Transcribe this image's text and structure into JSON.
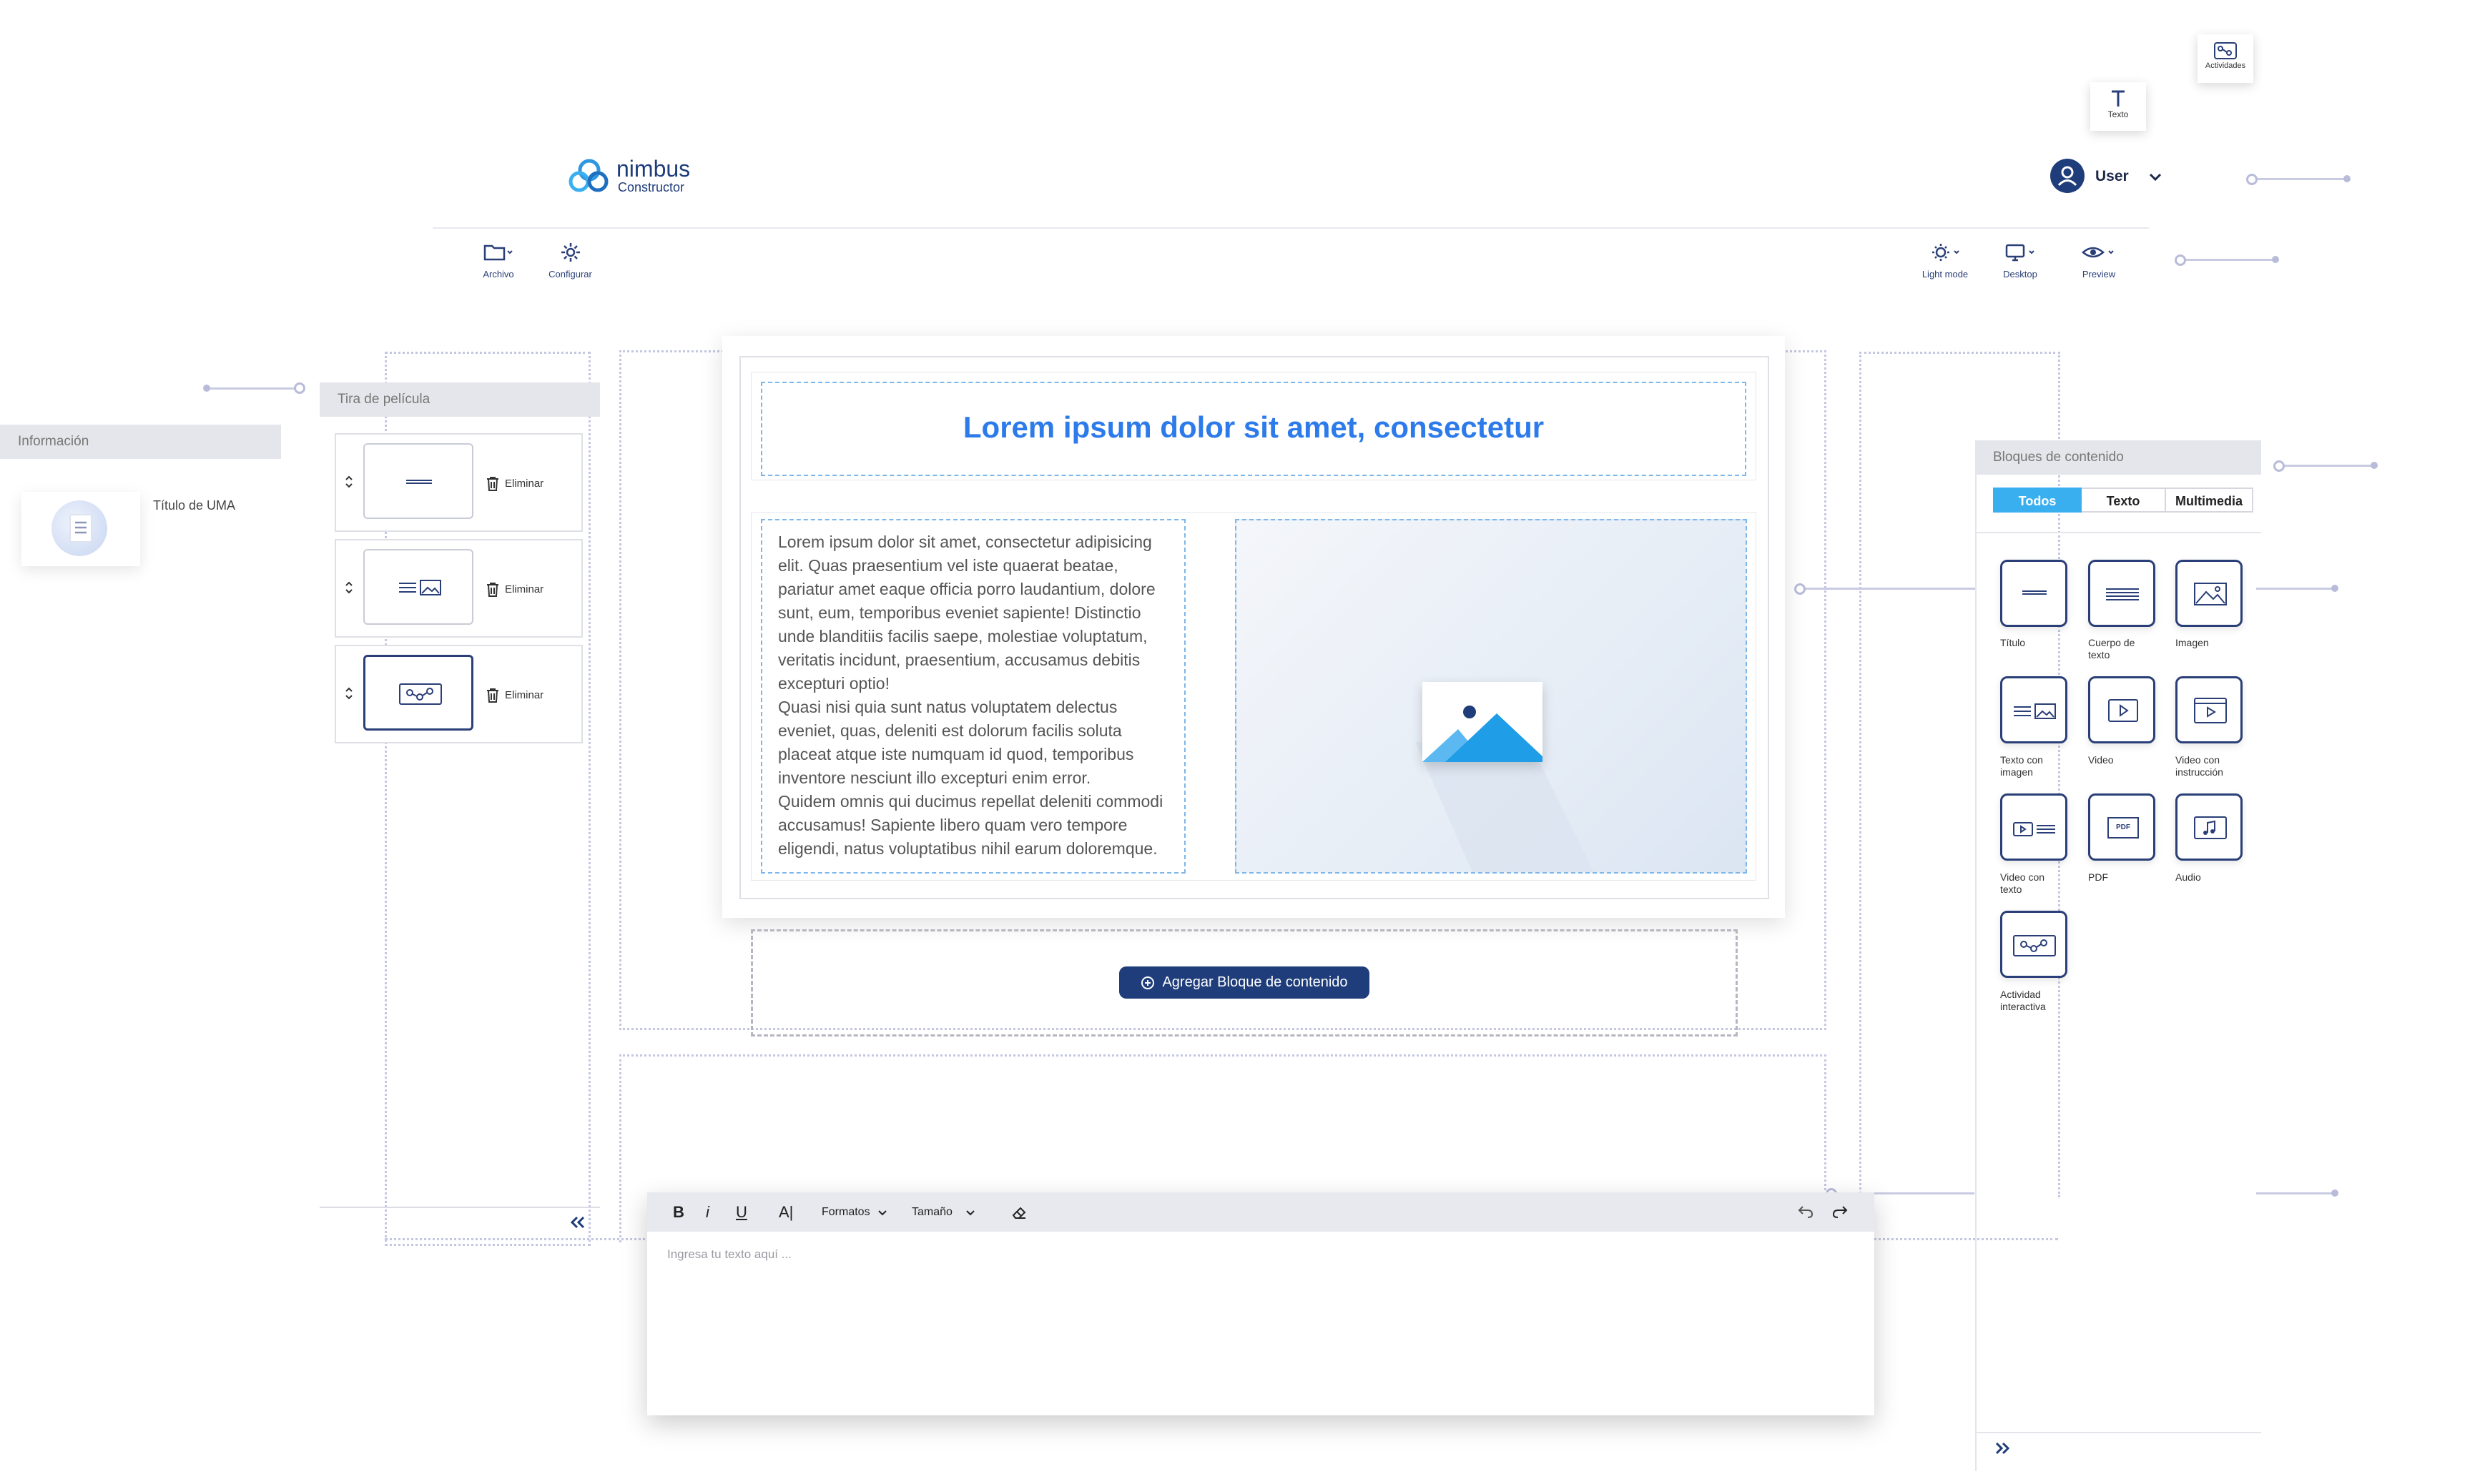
{
  "brand": {
    "name": "nimbus",
    "sub": "Constructor"
  },
  "user": {
    "name": "User"
  },
  "floating_chips": {
    "texto": "Texto",
    "actividades": "Actividades"
  },
  "toolbar": {
    "archivo": "Archivo",
    "configurar": "Configurar",
    "light_mode": "Light mode",
    "desktop": "Desktop",
    "preview": "Preview"
  },
  "info_panel": {
    "title": "Información",
    "item_label": "Título de UMA"
  },
  "filmstrip": {
    "title": "Tira de película",
    "rows": [
      {
        "delete_label": "Eliminar"
      },
      {
        "delete_label": "Eliminar"
      },
      {
        "delete_label": "Eliminar"
      }
    ]
  },
  "canvas": {
    "headline": "Lorem ipsum dolor sit amet, consectetur",
    "body_text": "Lorem ipsum dolor sit amet, consectetur adipisicing elit. Quas praesentium vel iste quaerat beatae, pariatur amet eaque officia porro laudantium, dolore sunt, eum, temporibus eveniet sapiente! Distinctio unde blanditiis facilis saepe, molestiae voluptatum, veritatis incidunt, praesentium, accusamus debitis excepturi optio!\nQuasi nisi quia sunt natus voluptatem delectus eveniet, quas, deleniti est dolorum facilis soluta placeat atque iste numquam id quod, temporibus inventore nesciunt illo excepturi enim error.\nQuidem omnis qui ducimus repellat deleniti commodi accusamus! Sapiente libero quam vero tempore eligendi, natus voluptatibus nihil earum doloremque.",
    "add_block_label": "Agregar Bloque de contenido"
  },
  "blocks_panel": {
    "title": "Bloques de contenido",
    "tabs": [
      "Todos",
      "Texto",
      "Multimedia"
    ],
    "active_tab": "Todos",
    "items": [
      {
        "label": "Título",
        "icon": "title-block-icon"
      },
      {
        "label": "Cuerpo de texto",
        "icon": "body-text-block-icon"
      },
      {
        "label": "Imagen",
        "icon": "image-block-icon"
      },
      {
        "label": "Texto con imagen",
        "icon": "text-image-block-icon"
      },
      {
        "label": "Video",
        "icon": "video-block-icon"
      },
      {
        "label": "Video con instrucción",
        "icon": "video-instruction-block-icon"
      },
      {
        "label": "Video con texto",
        "icon": "video-text-block-icon"
      },
      {
        "label": "PDF",
        "icon": "pdf-block-icon"
      },
      {
        "label": "Audio",
        "icon": "audio-block-icon"
      },
      {
        "label": "Actividad interactiva",
        "icon": "interactive-activity-block-icon"
      }
    ],
    "pdf_badge": "PDF"
  },
  "editor": {
    "bold": "B",
    "italic": "i",
    "underline": "U",
    "font_size_icon": "A|",
    "formatos": "Formatos",
    "tamano": "Tamaño",
    "placeholder": "Ingresa tu texto aquí ..."
  },
  "colors": {
    "accent": "#2d7bea",
    "navy": "#1e3d7a",
    "tab_active": "#3aaff0",
    "guide": "#c4c6e2"
  }
}
